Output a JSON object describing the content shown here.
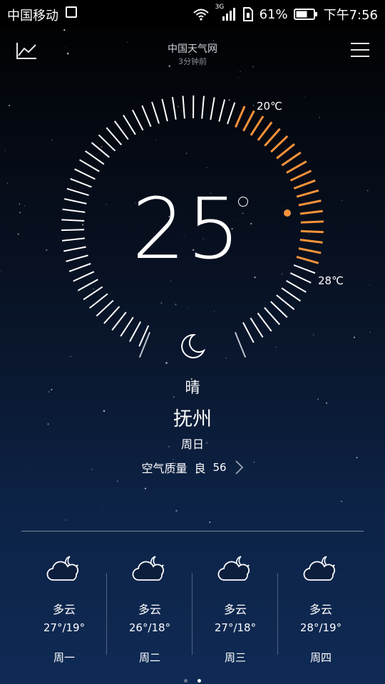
{
  "status_bar": {
    "carrier": "中国移动",
    "network": "3G",
    "battery": "61%",
    "time": "下午7:56"
  },
  "header": {
    "title": "中国天气网",
    "subtitle": "3分钟前",
    "left_icon": "trend-chart-icon",
    "right_icon": "menu-icon"
  },
  "current": {
    "temperature": "25",
    "low_label": "20℃",
    "high_label": "28℃",
    "condition": "晴",
    "city": "抚州",
    "weekday": "周日",
    "aqi_label": "空气质量",
    "aqi_level": "良",
    "aqi_value": "56"
  },
  "forecast": [
    {
      "condition": "多云",
      "temps": "27°/19°",
      "day": "周一",
      "icon": "cloud-moon-icon"
    },
    {
      "condition": "多云",
      "temps": "26°/18°",
      "day": "周二",
      "icon": "cloud-moon-icon"
    },
    {
      "condition": "多云",
      "temps": "27°/18°",
      "day": "周三",
      "icon": "cloud-moon-icon"
    },
    {
      "condition": "多云",
      "temps": "28°/19°",
      "day": "周四",
      "icon": "cloud-moon-icon"
    }
  ],
  "pager": {
    "pages": 2,
    "active": 2
  },
  "colors": {
    "accent": "#f7923a",
    "tick": "#ffffff"
  }
}
